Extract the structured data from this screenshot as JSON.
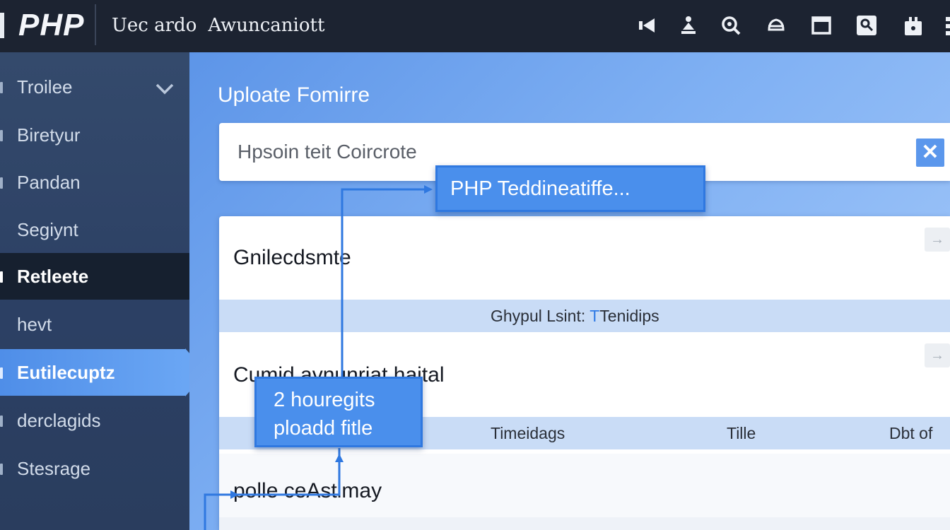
{
  "header": {
    "logo": "PHP",
    "subtitle_a": "Uec ardo",
    "subtitle_b": "Awuncaniott",
    "icons": [
      "back-icon",
      "upload-icon",
      "search-zoom-icon",
      "cloud-icon",
      "window-icon",
      "image-search-icon",
      "lock-icon",
      "more-icon"
    ]
  },
  "sidebar": {
    "items": [
      {
        "label": "Troilee"
      },
      {
        "label": "Biretyur"
      },
      {
        "label": "Pandan"
      },
      {
        "label": "Segiynt"
      },
      {
        "label": "Retleete"
      },
      {
        "label": "hevt"
      },
      {
        "label": "Eutilecuptz"
      },
      {
        "label": "derclagids"
      },
      {
        "label": "Stesrage"
      }
    ]
  },
  "main": {
    "title": "Uploate Fomirre",
    "search": {
      "placeholder": "Hpsoin teit Coircrote"
    },
    "rows": [
      {
        "title": "Gnilecdsmte"
      },
      {
        "band_a": "Ghypul Lsint:",
        "band_b": "Tenidips",
        "band_mark": "T"
      },
      {
        "title": "Cumid avnunriat haital"
      },
      {
        "col1": "Timeidags",
        "col2": "Tille",
        "col3": "Dbt of"
      },
      {
        "title": "polle ceAstimay"
      }
    ]
  },
  "tooltips": {
    "first": "PHP Teddineatiffe...",
    "second_line1": "2 houregits",
    "second_line2": "ploadd fitle"
  },
  "colors": {
    "topbar": "#1c2331",
    "sidebar": "#2c4064",
    "accent": "#4a8fec",
    "band": "#c9dcf6"
  }
}
